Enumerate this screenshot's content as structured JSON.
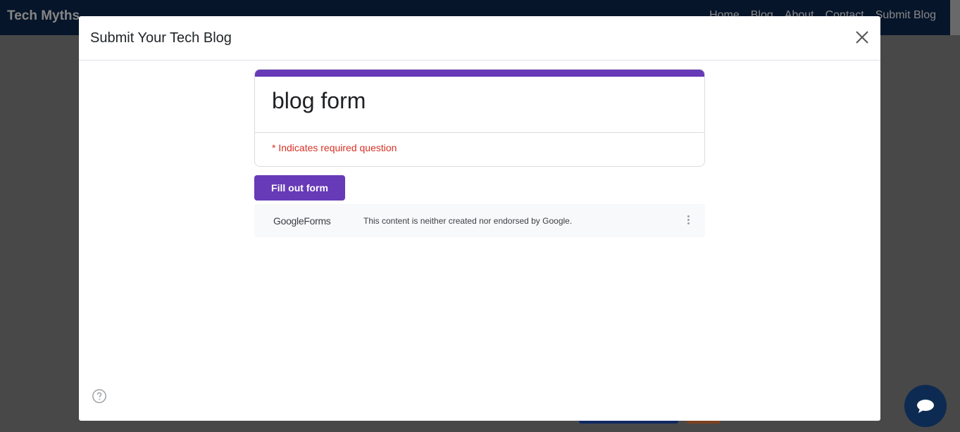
{
  "navbar": {
    "brand": "Tech Myths",
    "links": [
      "Home",
      "Blog",
      "About",
      "Contact",
      "Submit Blog"
    ]
  },
  "modal": {
    "title": "Submit Your Tech Blog"
  },
  "form": {
    "title": "blog form",
    "required_note": "* Indicates required question",
    "fill_button": "Fill out form",
    "footer_logo": "GoogleForms",
    "disclaimer": "This content is neither created nor endorsed by Google."
  },
  "colors": {
    "navbar": "#0d2a52",
    "form_accent": "#673ab7",
    "required": "#d93025"
  },
  "icons": {
    "close": "close-icon",
    "help": "help-icon",
    "more": "more-vert-icon",
    "chat": "chat-icon"
  }
}
